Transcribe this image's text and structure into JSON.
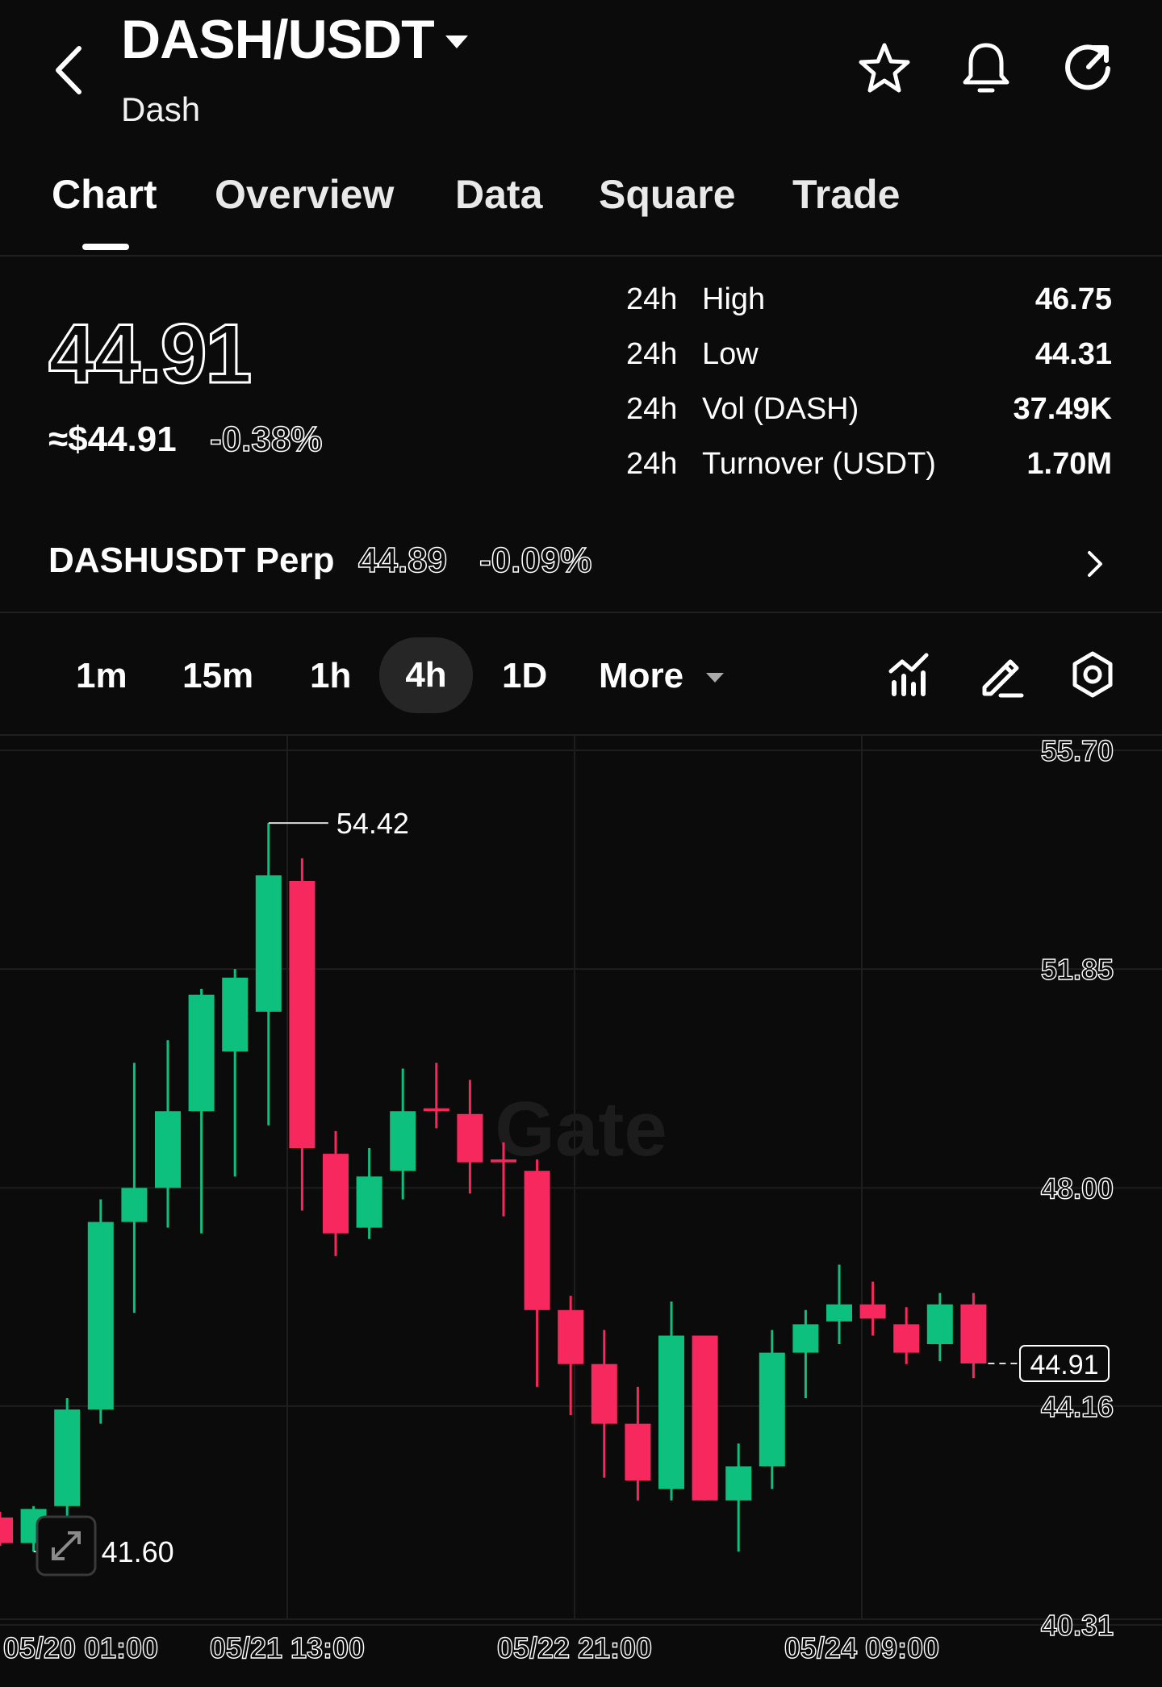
{
  "header": {
    "pair": "DASH/USDT",
    "name": "Dash",
    "icons": [
      "back-chevron-icon",
      "caret-down-icon",
      "star-icon",
      "bell-icon",
      "share-icon"
    ]
  },
  "tabs": [
    "Chart",
    "Overview",
    "Data",
    "Square",
    "Trade"
  ],
  "active_tab": "Chart",
  "ticker": {
    "price": "44.91",
    "approx_usd": "≈$44.91",
    "change": "-0.38%"
  },
  "stats": [
    {
      "period": "24h",
      "label": "High",
      "value": "46.75"
    },
    {
      "period": "24h",
      "label": "Low",
      "value": "44.31"
    },
    {
      "period": "24h",
      "label": "Vol (DASH)",
      "value": "37.49K"
    },
    {
      "period": "24h",
      "label": "Turnover (USDT)",
      "value": "1.70M"
    }
  ],
  "perp": {
    "name": "DASHUSDT Perp",
    "price": "44.89",
    "change": "-0.09%"
  },
  "intervals": [
    "1m",
    "15m",
    "1h",
    "4h",
    "1D",
    "More"
  ],
  "active_interval": "4h",
  "toolbar_icons": [
    "indicators-icon",
    "draw-pen-icon",
    "settings-hexagon-icon"
  ],
  "colors": {
    "background": "#0b0b0b",
    "up": "#0ec07e",
    "down": "#f6285e"
  },
  "chart_data": {
    "type": "candlestick",
    "watermark": "Gate",
    "y_ticks": [
      "55.70",
      "51.85",
      "48.00",
      "44.16",
      "40.31"
    ],
    "x_ticks": [
      "05/20 01:00",
      "05/21 13:00",
      "05/22 21:00",
      "05/24 09:00"
    ],
    "ylim": [
      40.31,
      55.7
    ],
    "high_label": "54.42",
    "low_label": "41.60",
    "last_price_label": "44.91",
    "candles": [
      {
        "o": 42.2,
        "h": 42.3,
        "l": 41.7,
        "c": 41.75
      },
      {
        "o": 41.75,
        "h": 42.4,
        "l": 41.6,
        "c": 42.35
      },
      {
        "o": 42.4,
        "h": 44.3,
        "l": 42.1,
        "c": 44.1
      },
      {
        "o": 44.1,
        "h": 47.8,
        "l": 43.85,
        "c": 47.4
      },
      {
        "o": 47.4,
        "h": 50.2,
        "l": 45.8,
        "c": 48.0
      },
      {
        "o": 48.0,
        "h": 50.6,
        "l": 47.3,
        "c": 49.35
      },
      {
        "o": 49.35,
        "h": 51.5,
        "l": 47.2,
        "c": 51.4
      },
      {
        "o": 50.4,
        "h": 51.85,
        "l": 48.2,
        "c": 51.7
      },
      {
        "o": 51.1,
        "h": 54.42,
        "l": 49.1,
        "c": 53.5
      },
      {
        "o": 53.4,
        "h": 53.8,
        "l": 47.6,
        "c": 48.7
      },
      {
        "o": 48.6,
        "h": 49.0,
        "l": 46.8,
        "c": 47.2
      },
      {
        "o": 47.3,
        "h": 48.7,
        "l": 47.1,
        "c": 48.2
      },
      {
        "o": 48.3,
        "h": 50.1,
        "l": 47.8,
        "c": 49.35
      },
      {
        "o": 49.4,
        "h": 50.2,
        "l": 49.05,
        "c": 49.35
      },
      {
        "o": 49.3,
        "h": 49.9,
        "l": 47.9,
        "c": 48.45
      },
      {
        "o": 48.5,
        "h": 48.8,
        "l": 47.5,
        "c": 48.45
      },
      {
        "o": 48.3,
        "h": 48.5,
        "l": 44.5,
        "c": 45.85
      },
      {
        "o": 45.85,
        "h": 46.1,
        "l": 44.0,
        "c": 44.9
      },
      {
        "o": 44.9,
        "h": 45.5,
        "l": 42.9,
        "c": 43.85
      },
      {
        "o": 43.85,
        "h": 44.5,
        "l": 42.5,
        "c": 42.85
      },
      {
        "o": 42.7,
        "h": 46.0,
        "l": 42.5,
        "c": 45.4
      },
      {
        "o": 45.4,
        "h": 45.4,
        "l": 42.5,
        "c": 42.5
      },
      {
        "o": 42.5,
        "h": 43.5,
        "l": 41.6,
        "c": 43.1
      },
      {
        "o": 43.1,
        "h": 45.5,
        "l": 42.7,
        "c": 45.1
      },
      {
        "o": 45.1,
        "h": 45.85,
        "l": 44.3,
        "c": 45.6
      },
      {
        "o": 45.65,
        "h": 46.65,
        "l": 45.25,
        "c": 45.95
      },
      {
        "o": 45.95,
        "h": 46.35,
        "l": 45.4,
        "c": 45.7
      },
      {
        "o": 45.6,
        "h": 45.9,
        "l": 44.9,
        "c": 45.1
      },
      {
        "o": 45.25,
        "h": 46.15,
        "l": 44.95,
        "c": 45.95
      },
      {
        "o": 45.95,
        "h": 46.15,
        "l": 44.65,
        "c": 44.91
      }
    ]
  }
}
